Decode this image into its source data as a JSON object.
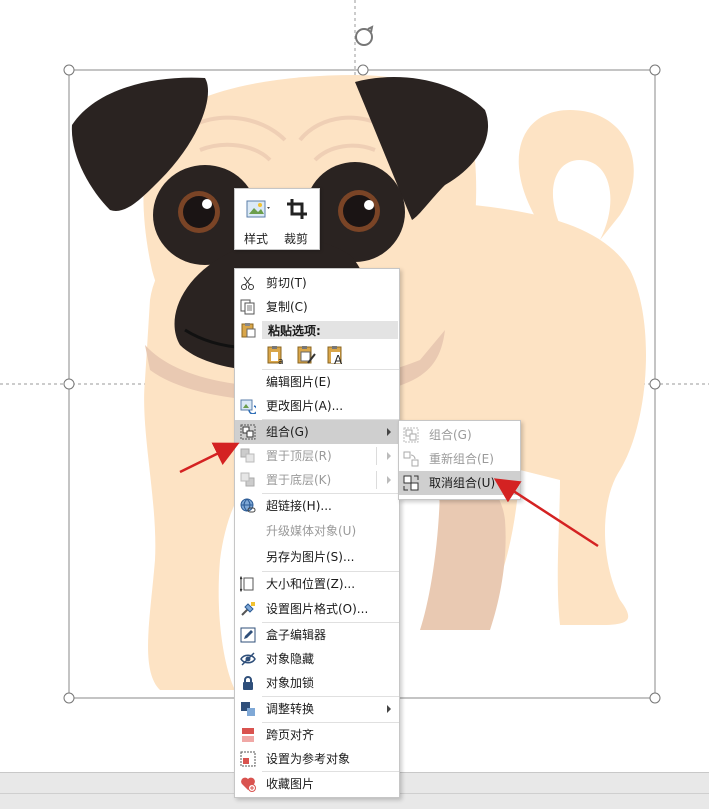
{
  "mini_toolbar": {
    "style_label": "样式",
    "crop_label": "裁剪"
  },
  "context_menu": {
    "items": [
      {
        "label": "剪切(T)",
        "icon": "scissors-icon",
        "enabled": true
      },
      {
        "label": "复制(C)",
        "icon": "copy-icon",
        "enabled": true
      },
      {
        "label": "粘贴选项:",
        "icon": "paste-icon",
        "enabled": true
      },
      {
        "label": "编辑图片(E)",
        "icon": "",
        "enabled": true
      },
      {
        "label": "更改图片(A)...",
        "icon": "change-picture-icon",
        "enabled": true
      },
      {
        "label": "组合(G)",
        "icon": "group-icon",
        "enabled": true,
        "submenu": true,
        "highlighted": true
      },
      {
        "label": "置于顶层(R)",
        "icon": "bring-to-front-icon",
        "enabled": false,
        "submenu": true
      },
      {
        "label": "置于底层(K)",
        "icon": "send-to-back-icon",
        "enabled": false,
        "submenu": true
      },
      {
        "label": "超链接(H)...",
        "icon": "hyperlink-icon",
        "enabled": true
      },
      {
        "label": "升级媒体对象(U)",
        "icon": "",
        "enabled": false
      },
      {
        "label": "另存为图片(S)...",
        "icon": "",
        "enabled": true
      },
      {
        "label": "大小和位置(Z)...",
        "icon": "size-position-icon",
        "enabled": true
      },
      {
        "label": "设置图片格式(O)...",
        "icon": "format-picture-icon",
        "enabled": true
      },
      {
        "label": "盒子编辑器",
        "icon": "edit-icon",
        "enabled": true
      },
      {
        "label": "对象隐藏",
        "icon": "hide-icon",
        "enabled": true
      },
      {
        "label": "对象加锁",
        "icon": "lock-icon",
        "enabled": true
      },
      {
        "label": "调整转换",
        "icon": "convert-icon",
        "enabled": true,
        "submenu": true
      },
      {
        "label": "跨页对齐",
        "icon": "align-icon",
        "enabled": true
      },
      {
        "label": "设置为参考对象",
        "icon": "reference-icon",
        "enabled": true
      },
      {
        "label": "收藏图片",
        "icon": "favorite-icon",
        "enabled": true
      }
    ]
  },
  "submenu": {
    "items": [
      {
        "label": "组合(G)",
        "enabled": false
      },
      {
        "label": "重新组合(E)",
        "enabled": false
      },
      {
        "label": "取消组合(U)",
        "enabled": true,
        "highlighted": true
      }
    ]
  },
  "colors": {
    "pug_body": "#fde3c4",
    "pug_shade": "#e9c9b2",
    "pug_dark": "#2a2321",
    "eye_brown": "#7a4426",
    "arrow_red": "#d42222",
    "menu_highlight": "#cfcfcf"
  }
}
